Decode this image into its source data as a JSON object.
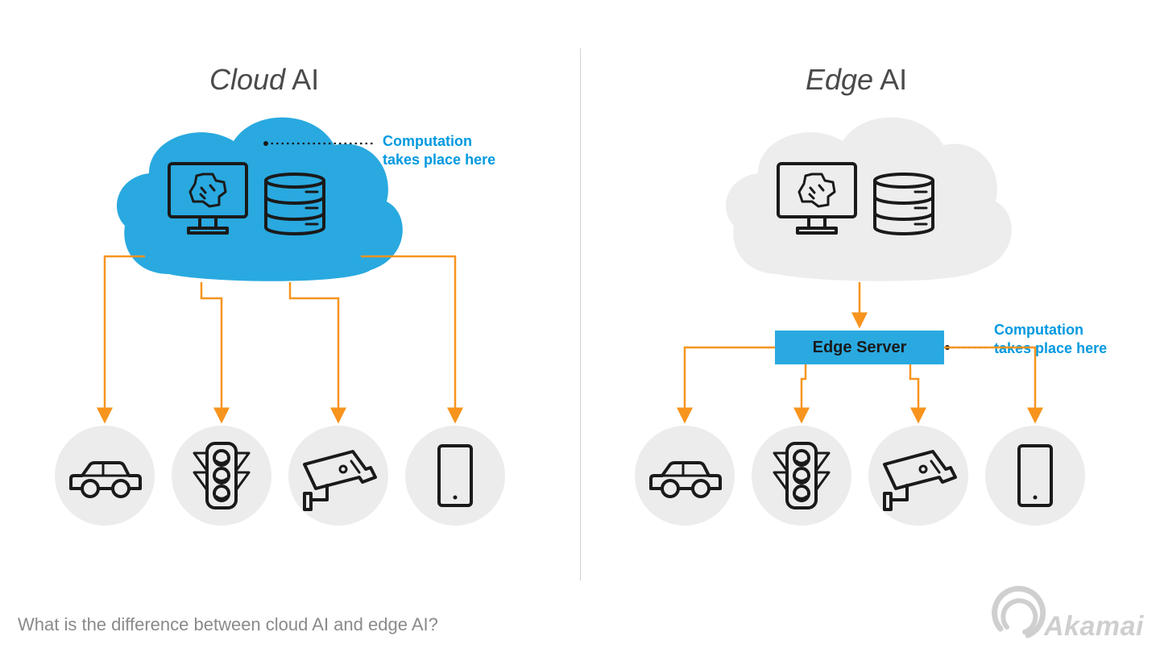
{
  "titles": {
    "left_italic": "Cloud",
    "left_rest": " AI",
    "right_italic": "Edge",
    "right_rest": " AI"
  },
  "callout": {
    "line1": "Computation",
    "line2": "takes place here"
  },
  "edge_server_label": "Edge Server",
  "footer": "What is the difference between cloud AI and edge AI?",
  "brand": "Akamai",
  "devices": [
    "car",
    "traffic-light",
    "cctv-camera",
    "phone"
  ],
  "colors": {
    "accent_blue": "#29a9e0",
    "arrow_orange": "#f7941d",
    "cloud_grey": "#ededed",
    "text_blue": "#0099e0"
  }
}
